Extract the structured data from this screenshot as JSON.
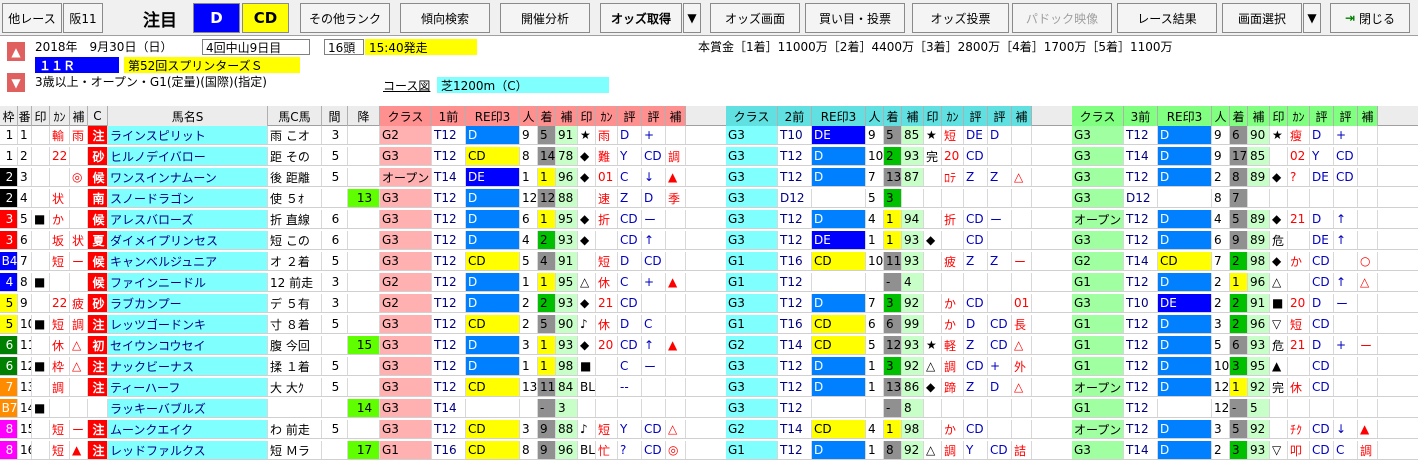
{
  "toolbar": {
    "b1": "他レース",
    "b2": "阪11",
    "label": "注目",
    "d": "D",
    "cd": "CD",
    "b3": "その他ランク",
    "b4": "傾向検索",
    "b5": "開催分析",
    "b6": "オッズ取得",
    "b7": "オッズ画面",
    "b8": "買い目・投票",
    "b9": "オッズ投票",
    "b10": "パドック映像",
    "b11": "レース結果",
    "b12": "画面選択",
    "b13": "閉じる"
  },
  "race": {
    "date": "2018年　9月30日（日）",
    "meeting": "4回中山9日目",
    "heads": "16頭",
    "start": "15:40発走",
    "race_no": "１１Ｒ",
    "name": "第52回スプリンターズＳ",
    "cond": "3歳以上・オープン・G1(定量)(国際)(指定)",
    "course_lbl": "コース図",
    "course": "芝1200m（C）",
    "prize": "本賞金［1着］11000万［2着］4400万［3着］2800万［4着］1700万［5着］1100万"
  },
  "header": [
    "枠",
    "番",
    "印",
    "ｶﾝ",
    "補",
    "C",
    "馬名S",
    "馬C馬",
    "間",
    "降",
    "クラス",
    "1前",
    "RE印3",
    "人",
    "着",
    "補",
    "印",
    "ｶﾝ",
    "評",
    "評",
    "補",
    "クラス",
    "2前",
    "RE印3",
    "人",
    "着",
    "補",
    "印",
    "ｶﾝ",
    "評",
    "評",
    "補",
    "クラス",
    "3前",
    "RE印3",
    "人",
    "着",
    "補",
    "印",
    "ｶﾝ",
    "評",
    "評",
    "補"
  ],
  "rows": [
    {
      "w": "1",
      "wc": "#ffffff",
      "n": "1",
      "m": "",
      "k": "輸",
      "h": "雨",
      "cc": "注",
      "name": "ラインスピリット",
      "hc": "雨 こオ",
      "iv": "3",
      "f": "",
      "g": [
        [
          "G2",
          "T12",
          "D",
          "9",
          "5",
          "91",
          "★",
          "雨",
          "D",
          "+",
          ""
        ],
        [
          "G3",
          "T10",
          "DE",
          "9",
          "5",
          "85",
          "★",
          "短",
          "DE",
          "D",
          ""
        ],
        [
          "G3",
          "T12",
          "D",
          "9",
          "6",
          "90",
          "★",
          "瘦",
          "D",
          "+",
          ""
        ]
      ]
    },
    {
      "w": "1",
      "wc": "#ffffff",
      "n": "2",
      "m": "",
      "k": "22",
      "h": "",
      "cc": "砂",
      "name": "ヒルノデイバロー",
      "hc": "距 その",
      "iv": "5",
      "f": "",
      "g": [
        [
          "G3",
          "T12",
          "CD",
          "8",
          "14",
          "78",
          "◆",
          "難",
          "Y",
          "CD",
          "調"
        ],
        [
          "G3",
          "T12",
          "D",
          "10",
          "2",
          "93",
          "完",
          "20",
          "CD",
          "",
          ""
        ],
        [
          "G3",
          "T14",
          "D",
          "9",
          "17",
          "85",
          "",
          "02",
          "Y",
          "CD",
          ""
        ]
      ]
    },
    {
      "w": "2",
      "wc": "#000000",
      "n": "3",
      "m": "",
      "k": "",
      "h": "◎",
      "cc": "候",
      "name": "ワンスインナムーン",
      "hc": "後 距離",
      "iv": "5",
      "f": "",
      "g": [
        [
          "オープン",
          "T14",
          "DE",
          "1",
          "1",
          "96",
          "◆",
          "01",
          "C",
          "↓",
          "▲"
        ],
        [
          "G3",
          "T12",
          "D",
          "7",
          "13",
          "87",
          "",
          "ﾛﾃ",
          "Z",
          "Z",
          "△"
        ],
        [
          "G3",
          "T12",
          "D",
          "2",
          "8",
          "89",
          "◆",
          "?",
          "DE",
          "CD",
          ""
        ]
      ]
    },
    {
      "w": "2",
      "wc": "#000000",
      "n": "4",
      "m": "",
      "k": "状",
      "h": "",
      "cc": "南",
      "name": "スノードラゴン",
      "hc": "使 ５ｵ",
      "iv": "",
      "f": "13",
      "g": [
        [
          "G3",
          "T12",
          "D",
          "12",
          "12",
          "88",
          "",
          "速",
          "Z",
          "D",
          "季"
        ],
        [
          "G3",
          "D12",
          "",
          "5",
          "3",
          "",
          "",
          "",
          "",
          "",
          ""
        ],
        [
          "G3",
          "D12",
          "",
          "8",
          "7",
          "",
          "",
          "",
          "",
          "",
          ""
        ]
      ]
    },
    {
      "w": "3",
      "wc": "#ff0000",
      "n": "5",
      "m": "■",
      "k": "か",
      "h": "",
      "cc": "候",
      "name": "アレスバローズ",
      "hc": "折 直線",
      "iv": "6",
      "f": "",
      "g": [
        [
          "G3",
          "T12",
          "D",
          "6",
          "1",
          "95",
          "◆",
          "折",
          "CD",
          "ー",
          ""
        ],
        [
          "G3",
          "T12",
          "D",
          "4",
          "1",
          "94",
          "",
          "折",
          "CD",
          "ー",
          ""
        ],
        [
          "オープン",
          "T12",
          "D",
          "4",
          "5",
          "89",
          "◆",
          "21",
          "D",
          "↑",
          ""
        ]
      ]
    },
    {
      "w": "3",
      "wc": "#ff0000",
      "n": "6",
      "m": "",
      "k": "坂",
      "h": "状",
      "cc": "夏",
      "name": "ダイメイプリンセス",
      "hc": "短 この",
      "iv": "6",
      "f": "",
      "g": [
        [
          "G3",
          "T12",
          "D",
          "4",
          "2",
          "93",
          "◆",
          "",
          "CD",
          "↑",
          ""
        ],
        [
          "G3",
          "T12",
          "DE",
          "1",
          "1",
          "93",
          "◆",
          "",
          "CD",
          "",
          ""
        ],
        [
          "G3",
          "T12",
          "D",
          "6",
          "9",
          "89",
          "危",
          "",
          "DE",
          "↑",
          ""
        ]
      ]
    },
    {
      "w": "B4",
      "wc": "#0000ff",
      "n": "7",
      "m": "",
      "k": "短",
      "h": "ー",
      "cc": "候",
      "name": "キャンベルジュニア",
      "hc": "オ ２着",
      "iv": "5",
      "f": "",
      "g": [
        [
          "G3",
          "T12",
          "CD",
          "5",
          "4",
          "91",
          "",
          "短",
          "D",
          "CD",
          ""
        ],
        [
          "G1",
          "T16",
          "CD",
          "10",
          "11",
          "93",
          "",
          "疲",
          "Z",
          "Z",
          "ー"
        ],
        [
          "G2",
          "T14",
          "CD",
          "7",
          "2",
          "98",
          "◆",
          "か",
          "CD",
          "",
          "○"
        ]
      ]
    },
    {
      "w": "4",
      "wc": "#0000ff",
      "n": "8",
      "m": "■",
      "k": "",
      "h": "",
      "cc": "候",
      "name": "ファインニードル",
      "hc": "12 前走",
      "iv": "3",
      "f": "",
      "g": [
        [
          "G2",
          "T12",
          "D",
          "1",
          "1",
          "95",
          "△",
          "休",
          "C",
          "+",
          "▲"
        ],
        [
          "G1",
          "T12",
          "",
          "",
          "-",
          "4",
          "",
          "",
          "",
          "",
          ""
        ],
        [
          "G1",
          "T12",
          "D",
          "2",
          "1",
          "96",
          "△",
          "",
          "CD",
          "↑",
          "△"
        ]
      ]
    },
    {
      "w": "5",
      "wc": "#ffff00",
      "n": "9",
      "m": "",
      "k": "22",
      "h": "疲",
      "cc": "砂",
      "name": "ラブカンプー",
      "hc": "デ ５有",
      "iv": "3",
      "f": "",
      "g": [
        [
          "G2",
          "T12",
          "D",
          "2",
          "2",
          "93",
          "◆",
          "21",
          "CD",
          "",
          " "
        ],
        [
          "G3",
          "T12",
          "D",
          "7",
          "3",
          "92",
          "",
          "か",
          "CD",
          "",
          "01"
        ],
        [
          "G3",
          "T10",
          "DE",
          "2",
          "2",
          "91",
          "■",
          "20",
          "D",
          "ー",
          ""
        ]
      ]
    },
    {
      "w": "5",
      "wc": "#ffff00",
      "n": "10",
      "m": "■",
      "k": "短",
      "h": "調",
      "cc": "注",
      "name": "レッツゴードンキ",
      "hc": "寸 ８着",
      "iv": "5",
      "f": "",
      "g": [
        [
          "G3",
          "T12",
          "CD",
          "2",
          "5",
          "90",
          "♪",
          "休",
          "D",
          "C",
          ""
        ],
        [
          "G1",
          "T16",
          "CD",
          "6",
          "6",
          "99",
          "",
          "か",
          "D",
          "CD",
          "長"
        ],
        [
          "G1",
          "T12",
          "D",
          "3",
          "2",
          "96",
          "▽",
          "短",
          "CD",
          "",
          " "
        ]
      ]
    },
    {
      "w": "6",
      "wc": "#008000",
      "n": "11",
      "m": "",
      "k": "休",
      "h": "△",
      "cc": "初",
      "name": "セイウンコウセイ",
      "hc": "腹 今回",
      "iv": "",
      "f": "15",
      "g": [
        [
          "G3",
          "T12",
          "D",
          "3",
          "1",
          "93",
          "◆",
          "20",
          "CD",
          "↑",
          "▲"
        ],
        [
          "G2",
          "T14",
          "CD",
          "5",
          "12",
          "93",
          "★",
          "軽",
          "Z",
          "CD",
          "△"
        ],
        [
          "G1",
          "T12",
          "D",
          "5",
          "6",
          "93",
          "危",
          "21",
          "D",
          "+",
          "ー"
        ]
      ]
    },
    {
      "w": "6",
      "wc": "#008000",
      "n": "12",
      "m": "■",
      "k": "枠",
      "h": "△",
      "cc": "注",
      "name": "ナックビーナス",
      "hc": "揉 １着",
      "iv": "5",
      "f": "",
      "g": [
        [
          "G3",
          "T12",
          "D",
          "1",
          "1",
          "98",
          "■",
          "",
          "C",
          "ー",
          ""
        ],
        [
          "G3",
          "T12",
          "D",
          "1",
          "3",
          "92",
          "△",
          "調",
          "CD",
          "+",
          "外"
        ],
        [
          "G1",
          "T12",
          "D",
          "10",
          "3",
          "95",
          "▲",
          "",
          "CD",
          "",
          ""
        ]
      ]
    },
    {
      "w": "7",
      "wc": "#ff8c00",
      "n": "13",
      "m": "",
      "k": "調",
      "h": "",
      "cc": "注",
      "name": "ティーハーフ",
      "hc": "大 大ｸ",
      "iv": "5",
      "f": "",
      "g": [
        [
          "G3",
          "T12",
          "CD",
          "13",
          "11",
          "84",
          "BL",
          "",
          "--",
          "",
          ""
        ],
        [
          "G3",
          "T12",
          "D",
          "1",
          "13",
          "86",
          "◆",
          "蹄",
          "Z",
          "D",
          "△"
        ],
        [
          "オープン",
          "T12",
          "D",
          "12",
          "1",
          "92",
          "完",
          "休",
          "CD",
          "",
          " "
        ]
      ]
    },
    {
      "w": "B7",
      "wc": "#ff8c00",
      "n": "14",
      "m": "■",
      "k": "",
      "h": "",
      "cc": "",
      "name": "ラッキーバブルズ",
      "hc": "",
      "iv": "",
      "f": "14",
      "g": [
        [
          "G3",
          "T14",
          "",
          "",
          "-",
          "3",
          "",
          "",
          "",
          "",
          ""
        ],
        [
          "G3",
          "T12",
          "",
          "",
          "-",
          "8",
          "",
          "",
          "",
          "",
          ""
        ],
        [
          "G1",
          "T12",
          "",
          "12",
          "-",
          "5",
          "",
          "",
          "",
          "",
          ""
        ]
      ]
    },
    {
      "w": "8",
      "wc": "#ff00ff",
      "n": "15",
      "m": "",
      "k": "短",
      "h": "ー",
      "cc": "注",
      "name": "ムーンクエイク",
      "hc": "わ 前走",
      "iv": "5",
      "f": "",
      "g": [
        [
          "G3",
          "T12",
          "CD",
          "3",
          "9",
          "88",
          "♪",
          "短",
          "Y",
          "CD",
          "△"
        ],
        [
          "G2",
          "T14",
          "CD",
          "4",
          "1",
          "98",
          "",
          "か",
          "CD",
          "",
          ""
        ],
        [
          "オープン",
          "T12",
          "D",
          "3",
          "5",
          "92",
          "",
          "ﾁｸ",
          "CD",
          "↓",
          "▲"
        ]
      ]
    },
    {
      "w": "8",
      "wc": "#ff00ff",
      "n": "16",
      "m": "",
      "k": "短",
      "h": "▲",
      "cc": "注",
      "name": "レッドファルクス",
      "hc": "短 Ｍラ",
      "iv": "",
      "f": "17",
      "g": [
        [
          "G1",
          "T16",
          "CD",
          "8",
          "9",
          "96",
          "BL",
          "忙",
          "?",
          "CD",
          "◎"
        ],
        [
          "G1",
          "T12",
          "D",
          "1",
          "8",
          "92",
          "△",
          "調",
          "Y",
          "CD",
          "詰"
        ],
        [
          "G3",
          "T14",
          "D",
          "2",
          "3",
          "93",
          "▽",
          "叩",
          "CD",
          "C",
          "調"
        ]
      ]
    }
  ]
}
